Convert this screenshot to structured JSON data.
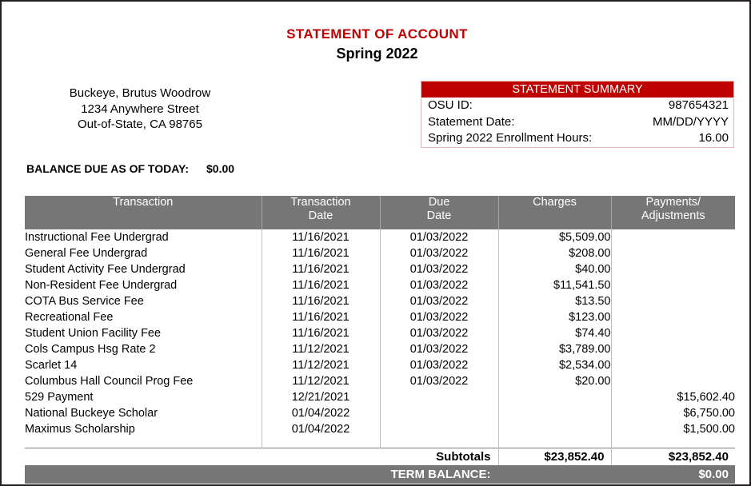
{
  "document": {
    "title": "STATEMENT OF ACCOUNT",
    "subtitle": "Spring 2022",
    "title_color": "#c00000"
  },
  "address": {
    "name": "Buckeye, Brutus Woodrow",
    "street": "1234 Anywhere Street",
    "city_state_zip": "Out-of-State, CA 98765"
  },
  "summary": {
    "header": "STATEMENT SUMMARY",
    "rows": [
      {
        "label": "OSU ID:",
        "value": "987654321"
      },
      {
        "label": "Statement Date:",
        "value": "MM/DD/YYYY"
      },
      {
        "label": "Spring 2022 Enrollment Hours:",
        "value": "16.00"
      }
    ]
  },
  "balance_due": {
    "label": "BALANCE DUE AS OF TODAY:",
    "value": "$0.00"
  },
  "table": {
    "headers": {
      "transaction": "Transaction",
      "transaction_date_line1": "Transaction",
      "transaction_date_line2": "Date",
      "due_date_line1": "Due",
      "due_date_line2": "Date",
      "charges": "Charges",
      "payments_line1": "Payments/",
      "payments_line2": "Adjustments"
    },
    "rows": [
      {
        "description": "Instructional Fee Undergrad",
        "transaction_date": "11/16/2021",
        "due_date": "01/03/2022",
        "charges": "$5,509.00",
        "payments": ""
      },
      {
        "description": "General Fee Undergrad",
        "transaction_date": "11/16/2021",
        "due_date": "01/03/2022",
        "charges": "$208.00",
        "payments": ""
      },
      {
        "description": "Student Activity Fee Undergrad",
        "transaction_date": "11/16/2021",
        "due_date": "01/03/2022",
        "charges": "$40.00",
        "payments": ""
      },
      {
        "description": "Non-Resident Fee Undergrad",
        "transaction_date": "11/16/2021",
        "due_date": "01/03/2022",
        "charges": "$11,541.50",
        "payments": ""
      },
      {
        "description": "COTA Bus Service Fee",
        "transaction_date": "11/16/2021",
        "due_date": "01/03/2022",
        "charges": "$13.50",
        "payments": ""
      },
      {
        "description": "Recreational Fee",
        "transaction_date": "11/16/2021",
        "due_date": "01/03/2022",
        "charges": "$123.00",
        "payments": ""
      },
      {
        "description": "Student Union Facility Fee",
        "transaction_date": "11/16/2021",
        "due_date": "01/03/2022",
        "charges": "$74.40",
        "payments": ""
      },
      {
        "description": "Cols Campus Hsg Rate 2",
        "transaction_date": "11/12/2021",
        "due_date": "01/03/2022",
        "charges": "$3,789.00",
        "payments": ""
      },
      {
        "description": "Scarlet 14",
        "transaction_date": "11/12/2021",
        "due_date": "01/03/2022",
        "charges": "$2,534.00",
        "payments": ""
      },
      {
        "description": "Columbus Hall Council Prog Fee",
        "transaction_date": "11/12/2021",
        "due_date": "01/03/2022",
        "charges": "$20.00",
        "payments": ""
      },
      {
        "description": "529 Payment",
        "transaction_date": "12/21/2021",
        "due_date": "",
        "charges": "",
        "payments": "$15,602.40"
      },
      {
        "description": "National Buckeye Scholar",
        "transaction_date": "01/04/2022",
        "due_date": "",
        "charges": "",
        "payments": "$6,750.00"
      },
      {
        "description": "Maximus Scholarship",
        "transaction_date": "01/04/2022",
        "due_date": "",
        "charges": "",
        "payments": "$1,500.00"
      }
    ],
    "subtotals": {
      "label": "Subtotals",
      "charges": "$23,852.40",
      "payments": "$23,852.40"
    },
    "term_balance": {
      "label": "TERM BALANCE:",
      "value": "$0.00"
    }
  }
}
